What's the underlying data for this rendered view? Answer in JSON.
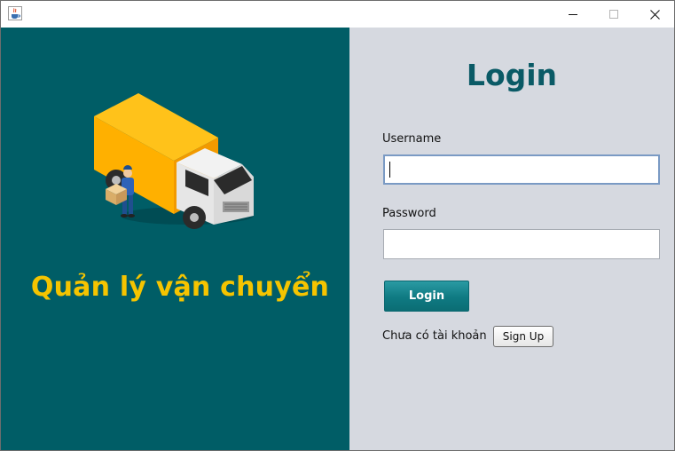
{
  "window": {
    "minimize_icon": "minimize-icon",
    "maximize_icon": "maximize-icon",
    "close_icon": "close-icon",
    "app_icon": "java-cup-icon"
  },
  "branding": {
    "title": "Quản lý vận chuyển",
    "illustration": "delivery-truck-illustration",
    "background_color": "#005d66",
    "title_color": "#f5c400"
  },
  "login": {
    "heading": "Login",
    "username_label": "Username",
    "username_value": "",
    "password_label": "Password",
    "password_value": "",
    "login_button": "Login",
    "no_account_text": "Chưa có tài khoản",
    "signup_button": "Sign Up",
    "heading_color": "#0a5a66",
    "panel_color": "#d6d9e0"
  }
}
